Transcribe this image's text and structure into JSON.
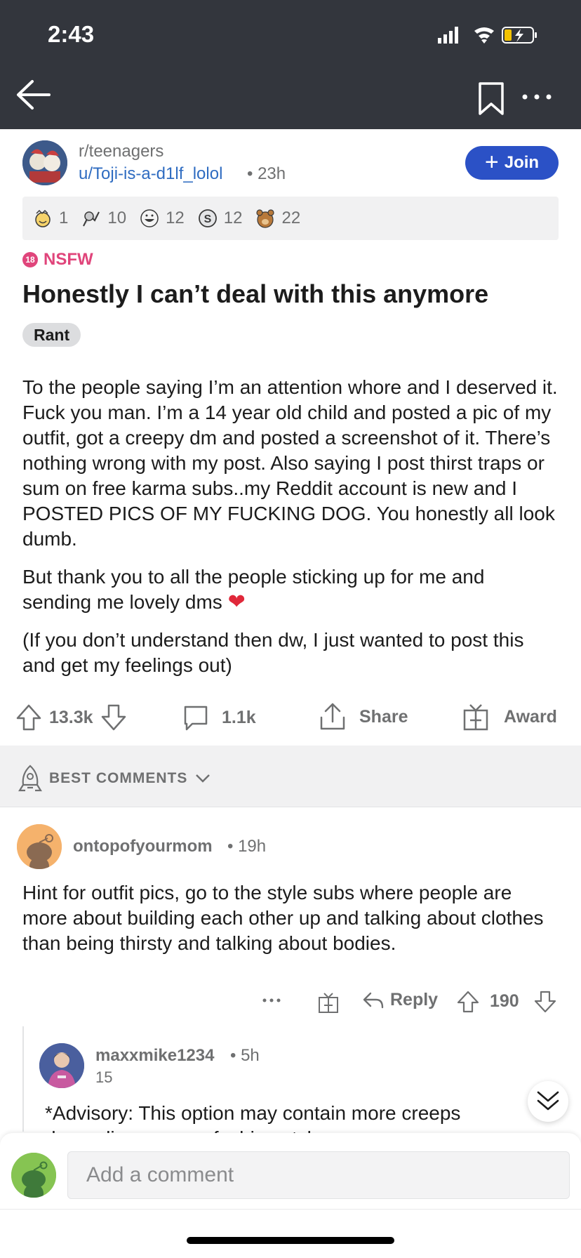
{
  "status_bar": {
    "time": "2:43"
  },
  "post": {
    "subreddit": "r/teenagers",
    "author": "u/Toji-is-a-d1lf_lolol",
    "time": "• 23h",
    "join_label": "Join",
    "join_icon": "+",
    "awards": [
      {
        "icon": "wholesome-award-icon",
        "count": "1"
      },
      {
        "icon": "helpful-award-icon",
        "count": "10"
      },
      {
        "icon": "haha-award-icon",
        "count": "12"
      },
      {
        "icon": "silver-award-icon",
        "count": "12"
      },
      {
        "icon": "hugz-award-icon",
        "count": "22"
      }
    ],
    "nsfw_badge": "18",
    "nsfw_label": "NSFW",
    "title": "Honestly I can’t deal with this anymore",
    "flair": "Rant",
    "body": [
      "To the people saying I’m an attention whore and I deserved it. Fuck you man. I’m a 14 year old child and posted a pic of my outfit, got a creepy dm and posted a screenshot of it. There’s nothing wrong with my post. Also saying I post thirst traps or sum on free karma subs..my Reddit account is new and I POSTED PICS OF MY FUCKING DOG. You honestly all look dumb.",
      "But thank you to all the people sticking up for me and sending me lovely dms",
      "(If you don’t understand then dw, I just wanted to post this and get my feelings out)"
    ],
    "heart": "❤",
    "votes": "13.3k",
    "comments": "1.1k",
    "share_label": "Share",
    "award_label": "Award"
  },
  "sort": {
    "label": "BEST COMMENTS"
  },
  "comments": [
    {
      "user": "ontopofyourmom",
      "time": "• 19h",
      "body": "Hint for outfit pics, go to the style subs where people are more about building each other up and talking about clothes than being thirsty and talking about bodies.",
      "reply_label": "Reply",
      "score": "190"
    }
  ],
  "reply": {
    "user": "maxxmike1234",
    "time": "• 5h",
    "score": "15",
    "body_line1": "*Advisory: This option may contain more creeps",
    "body_line2": "depending on your fashion style"
  },
  "composer": {
    "placeholder": "Add a comment"
  },
  "colors": {
    "join": "#2b51c6",
    "nsfw": "#e0457b",
    "link": "#2f6cc1",
    "topbar": "#33363d"
  }
}
